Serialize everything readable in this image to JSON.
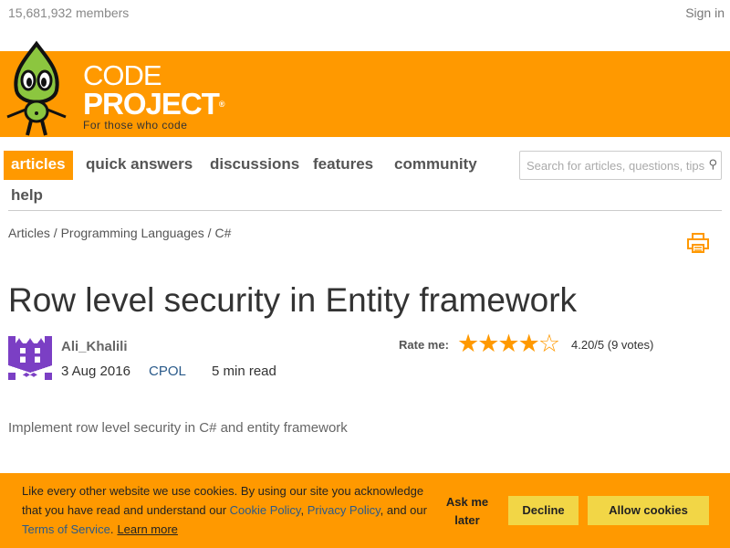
{
  "header": {
    "members": "15,681,932 members",
    "sign_in": "Sign in"
  },
  "logo": {
    "line1": "CODE",
    "line2": "PROJECT",
    "reg": "®",
    "tagline": "For those who code"
  },
  "nav": {
    "items": [
      {
        "label": "articles",
        "active": true
      },
      {
        "label": "quick answers"
      },
      {
        "label": "discussions"
      },
      {
        "label": "features"
      },
      {
        "label": "community"
      },
      {
        "label": "help"
      }
    ]
  },
  "search": {
    "placeholder": "Search for articles, questions, tips",
    "icon": "search-icon"
  },
  "breadcrumb": {
    "items": [
      "Articles",
      "Programming Languages",
      "C#"
    ],
    "sep": " / "
  },
  "article": {
    "title": "Row level security in Entity framework",
    "author": "Ali_Khalili",
    "date": "3 Aug 2016",
    "license": "CPOL",
    "read_time": "5 min read",
    "rate_label": "Rate me:",
    "rating": 4.2,
    "stars": "★★★★☆",
    "score": "4.20/5 (9 votes)",
    "summary": "Implement row level security in C# and entity framework"
  },
  "cookie": {
    "text1": "Like every other website we use cookies. By using our site you acknowledge that you have read and understand our ",
    "cookie_policy": "Cookie Policy",
    "comma": ", ",
    "privacy_policy": "Privacy Policy",
    "and_our": ", and our ",
    "terms": "Terms of Service",
    "period": ".",
    "learn_more": "Learn more",
    "ask_later": "Ask me later",
    "decline": "Decline",
    "allow": "Allow cookies"
  },
  "colors": {
    "brand": "#ff9900",
    "button": "#f2d646",
    "avatar": "#7b3fc4"
  }
}
